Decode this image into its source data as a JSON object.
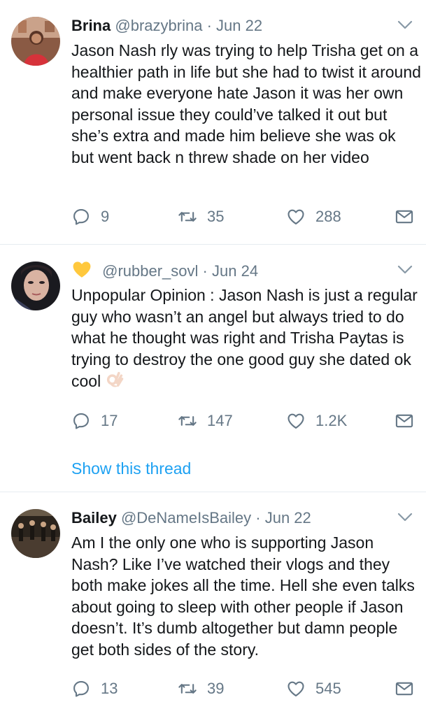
{
  "tweets": [
    {
      "name": "Brina",
      "handle": "@brazybrina",
      "dot": "·",
      "date": "Jun 22",
      "text": "Jason Nash rly was trying to help Trisha get on a healthier path in life but she had to twist it around and make everyone hate Jason it was her own personal issue they could’ve talked it out but she’s extra and made him believe she was ok but went back n threw shade on her video",
      "replies": "9",
      "retweets": "35",
      "likes": "288"
    },
    {
      "name": "",
      "handle": "@rubber_sovl",
      "dot": "·",
      "date": "Jun 24",
      "text": "Unpopular Opinion : Jason Nash is just a regular guy who wasn’t an angel but always tried to do what he thought was right and Trisha Paytas is trying to destroy the one good guy she dated ok cool",
      "replies": "17",
      "retweets": "147",
      "likes": "1.2K",
      "show_thread": "Show this thread"
    },
    {
      "name": "Bailey",
      "handle": "@DeNameIsBailey",
      "dot": "·",
      "date": "Jun 22",
      "text": "Am I the only one who is supporting Jason Nash? Like I’ve watched their vlogs and they both make jokes all the time. Hell she even talks about going to sleep with other people if Jason doesn’t. It’s dumb altogether but damn people get both sides of the story.",
      "replies": "13",
      "retweets": "39",
      "likes": "545"
    }
  ],
  "icons": [
    "reply-icon",
    "retweet-icon",
    "like-icon",
    "message-icon",
    "chevron-down-icon",
    "yellow-heart-icon",
    "ok-hand-icon"
  ],
  "colors": {
    "text": "#14171a",
    "muted": "#657786",
    "link": "#1da1f2",
    "separator": "#e6ecf0"
  }
}
